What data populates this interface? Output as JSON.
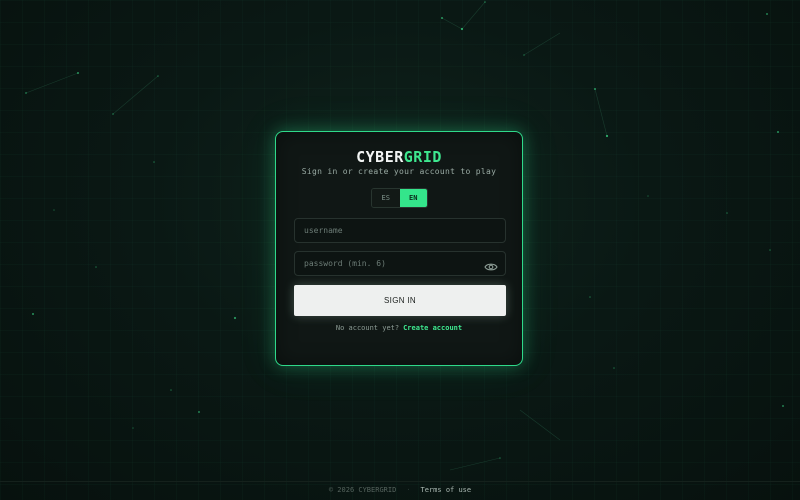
{
  "brand": {
    "logo_part_a": "CYBER",
    "logo_part_b": "GRID",
    "subtitle": "Sign in or create your account to play"
  },
  "language": {
    "options": [
      "ES",
      "EN"
    ],
    "selected": "EN"
  },
  "form": {
    "username_placeholder": "username",
    "username_value": "",
    "password_placeholder": "password (min. 6)",
    "password_value": "",
    "password_toggle_icon": "eye-icon",
    "submit_label": "SIGN IN"
  },
  "register": {
    "prompt": "No account yet?",
    "link_label": "Create account"
  },
  "footer": {
    "copyright": "© 2026 CYBERGRID",
    "separator": "·",
    "terms_label": "Terms of use"
  },
  "theme": {
    "background": "#0a1814",
    "accent": "#34e58b",
    "card_border": "#2fd98a",
    "button_bg": "#eef0ef"
  }
}
